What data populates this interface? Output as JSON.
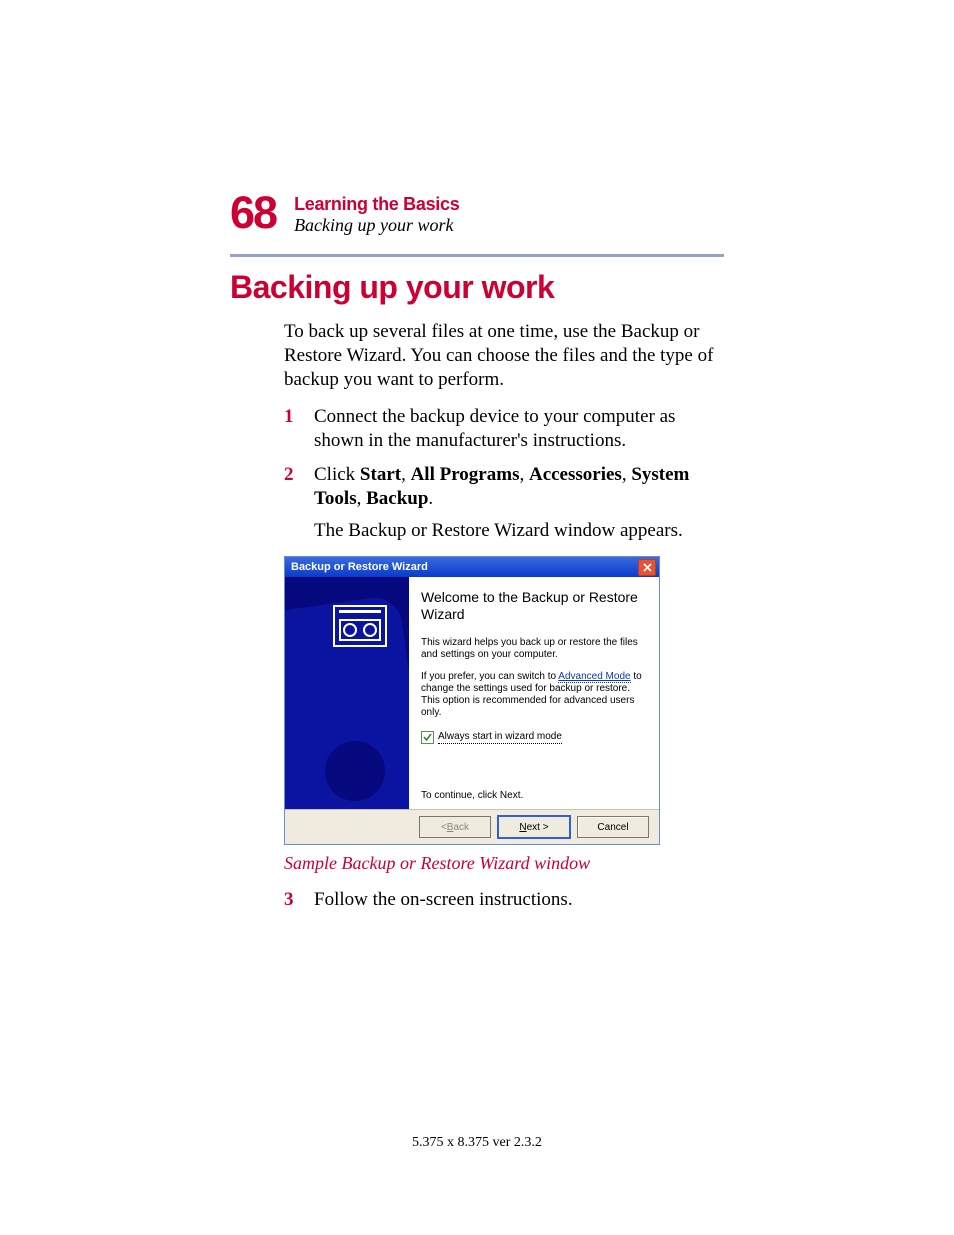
{
  "page": {
    "number": "68",
    "chapter": "Learning the Basics",
    "section": "Backing up your work",
    "heading": "Backing up your work",
    "intro": "To back up several files at one time, use the Backup or Restore Wizard. You can choose the files and the type of backup you want to perform.",
    "step1": "Connect the backup device to your computer as shown in the manufacturer's instructions.",
    "step2_prefix": "Click ",
    "step2_b1": "Start",
    "step2_b2": "All Programs",
    "step2_b3": "Accessories",
    "step2_b4": "System Tools",
    "step2_b5": "Backup",
    "step2_follow": "The Backup or Restore Wizard window appears.",
    "caption": "Sample Backup or Restore Wizard window",
    "step3": "Follow the on-screen instructions.",
    "footer": "5.375 x 8.375 ver 2.3.2"
  },
  "wizard": {
    "title": "Backup or Restore Wizard",
    "heading": "Welcome to the Backup or Restore Wizard",
    "desc": "This wizard helps you back up or restore the files and settings on your computer.",
    "adv_pre": "If you prefer, you can switch to ",
    "adv_link": "Advanced Mode",
    "adv_post": " to change the settings used for backup or restore. This option is recommended for advanced users only.",
    "checkbox_label": "Always start in wizard mode",
    "continue": "To continue, click Next.",
    "back_prefix": "< ",
    "back_u": "B",
    "back_rest": "ack",
    "next_u": "N",
    "next_rest": "ext >",
    "cancel": "Cancel"
  }
}
